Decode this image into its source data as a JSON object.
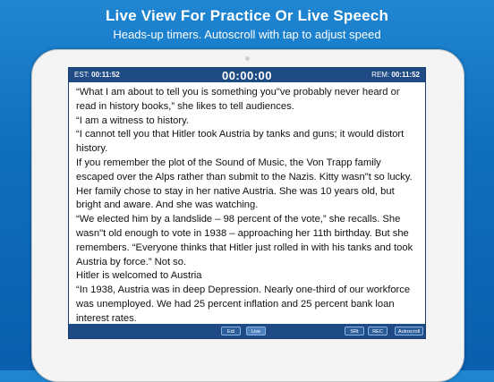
{
  "banner": {
    "headline": "Live View For Practice Or Live Speech",
    "subheadline": "Heads-up timers. Autoscroll with tap to adjust speed"
  },
  "app": {
    "est_label": "EST:",
    "est_time": "00:11:52",
    "clock": "00:00:00",
    "rem_label": "REM:",
    "rem_time": "00:11:52",
    "paragraphs": [
      "“What I am about to tell you is something you\"ve probably never heard or read in history books,” she likes to tell audiences.",
      "“I am a witness to history.",
      "“I cannot tell you that Hitler took Austria by tanks and guns; it would distort history.",
      "If you remember the plot of the Sound of Music, the Von Trapp family escaped over the Alps rather than submit to the Nazis. Kitty wasn\"t so lucky. Her family chose to stay in her native Austria. She was 10 years old, but bright and aware. And she was watching.",
      "“We elected him by a landslide – 98 percent of the vote,” she recalls. She wasn\"t old enough to vote in 1938 – approaching her 11th birthday. But she remembers. “Everyone thinks that Hitler just rolled in with his tanks and took Austria by force.” Not so.",
      "Hitler is welcomed to Austria",
      "“In 1938, Austria was in deep Depression. Nearly one-third of our workforce was unemployed. We had 25 percent inflation and 25 percent bank loan interest rates."
    ],
    "buttons": {
      "edit": "Edi",
      "live": "Live",
      "srt": "SRt",
      "rec": "REC",
      "autoscroll": "Autoscroll"
    }
  }
}
